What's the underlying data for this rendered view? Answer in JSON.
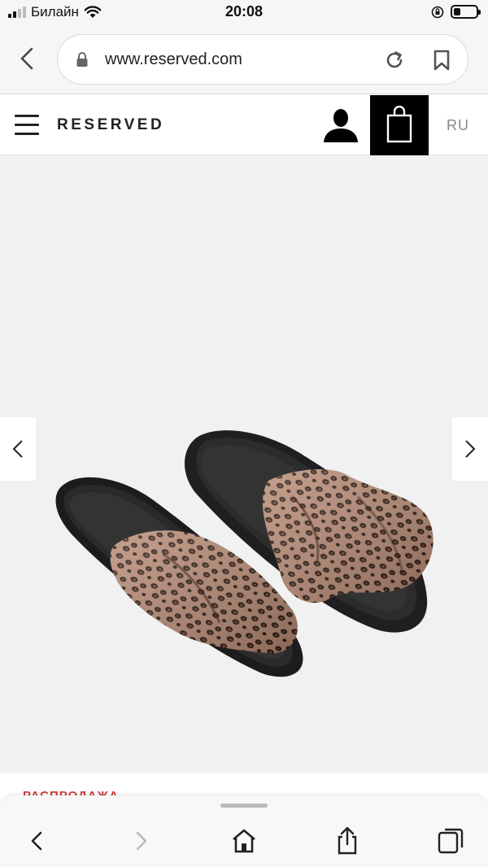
{
  "status_bar": {
    "carrier": "Билайн",
    "time": "20:08",
    "battery_level": 0.3
  },
  "browser": {
    "url": "www.reserved.com",
    "icons": [
      "back-icon",
      "lock-icon",
      "reload-icon",
      "bookmark-icon"
    ]
  },
  "header": {
    "brand": "RESERVED",
    "language": "RU",
    "icons": [
      "menu-icon",
      "account-icon",
      "shopping-bag-icon"
    ]
  },
  "product": {
    "image_description": "leopard print bow slide sandals",
    "sale_label": "РАСПРОДАЖА"
  },
  "toolbar": {
    "icons": [
      "back-icon",
      "forward-icon",
      "home-icon",
      "share-icon",
      "tabs-icon"
    ]
  },
  "colors": {
    "accent_sale": "#d13b3b",
    "cart_bg": "#000000",
    "gallery_bg": "#f1f1f1"
  }
}
